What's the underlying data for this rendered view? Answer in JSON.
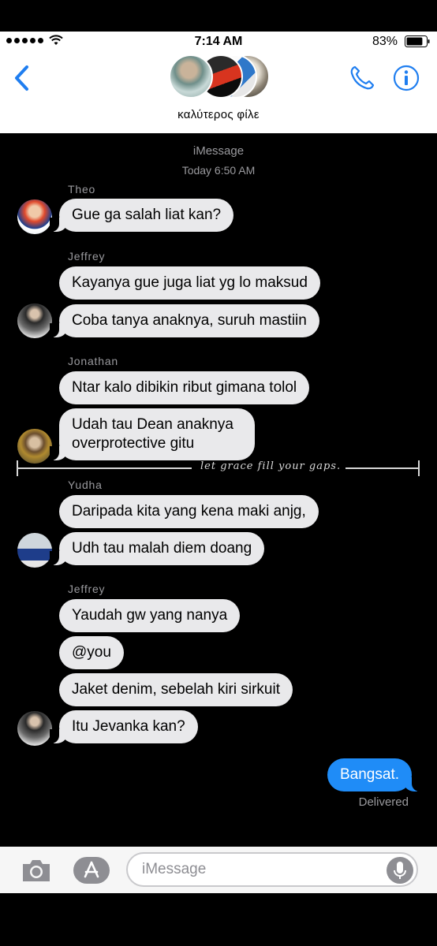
{
  "status_bar": {
    "time": "7:14 AM",
    "battery": "83%",
    "battery_level": 0.83
  },
  "header": {
    "group_name": "καλύτερος φίλε",
    "back_icon": "chevron-left-icon",
    "call_icon": "phone-icon",
    "info_icon": "info-icon",
    "accent_color": "#1f7ef0"
  },
  "chat": {
    "service": "iMessage",
    "timestamp": "Today 6:50 AM",
    "groups": [
      {
        "sender": "Theo",
        "messages": [
          "Gue ga salah liat kan?"
        ]
      },
      {
        "sender": "Jeffrey",
        "messages": [
          "Kayanya gue juga liat yg lo maksud",
          "Coba tanya anaknya, suruh mastiin"
        ]
      },
      {
        "sender": "Jonathan",
        "messages": [
          "Ntar kalo dibikin ribut gimana tolol",
          "Udah tau Dean anaknya overprotective gitu"
        ]
      },
      {
        "sender": "Yudha",
        "messages": [
          "Daripada kita yang kena maki anjg,",
          "Udh tau malah diem doang"
        ]
      },
      {
        "sender": "Jeffrey",
        "messages": [
          "Yaudah gw yang nanya",
          "@you",
          "Jaket denim, sebelah kiri sirkuit",
          "Itu Jevanka kan?"
        ]
      }
    ],
    "outgoing": "Bangsat.",
    "delivery_status": "Delivered",
    "watermark_text": "let grace fill your gaps.",
    "incoming_bubble_color": "#e9e9eb",
    "outgoing_bubble_color": "#1f8cf7"
  },
  "input_bar": {
    "placeholder": "iMessage",
    "camera_icon": "camera-icon",
    "apps_icon": "app-store-icon",
    "mic_icon": "microphone-icon"
  }
}
